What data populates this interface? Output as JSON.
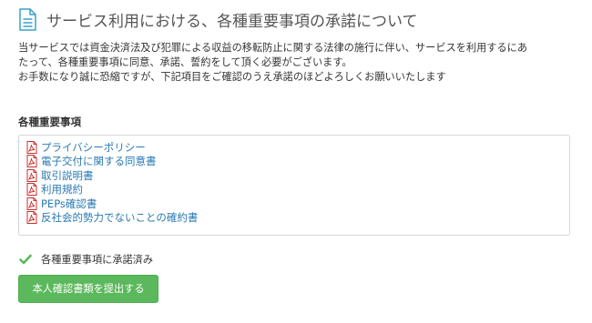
{
  "header": {
    "title": "サービス利用における、各種重要事項の承諾について",
    "icon": "document-icon",
    "icon_color": "#3aa0c8"
  },
  "intro": {
    "line1": "当サービスでは資金決済法及び犯罪による収益の移転防止に関する法律の施行に伴い、サービスを利用するにあ",
    "line2": "たって、各種重要事項に同意、承諾、誓約をして頂く必要がございます。",
    "line3": "お手数になり誠に恐縮ですが、下記項目をご確認のうえ承諾のほどよろしくお願いいたします"
  },
  "documents": {
    "heading": "各種重要事項",
    "link_color": "#2a7ab3",
    "icon": "pdf-icon",
    "icon_color": "#c9302c",
    "items": [
      {
        "label": "プライバシーポリシー"
      },
      {
        "label": "電子交付に関する同意書"
      },
      {
        "label": "取引説明書"
      },
      {
        "label": "利用規約"
      },
      {
        "label": "PEPs確認書"
      },
      {
        "label": "反社会的勢力でないことの確約書"
      }
    ]
  },
  "consent": {
    "label": "各種重要事項に承諾済み",
    "checked": true,
    "icon": "checkmark-icon",
    "check_color": "#5cb85c"
  },
  "submit": {
    "label": "本人確認書類を提出する",
    "color": "#5cb85c"
  }
}
